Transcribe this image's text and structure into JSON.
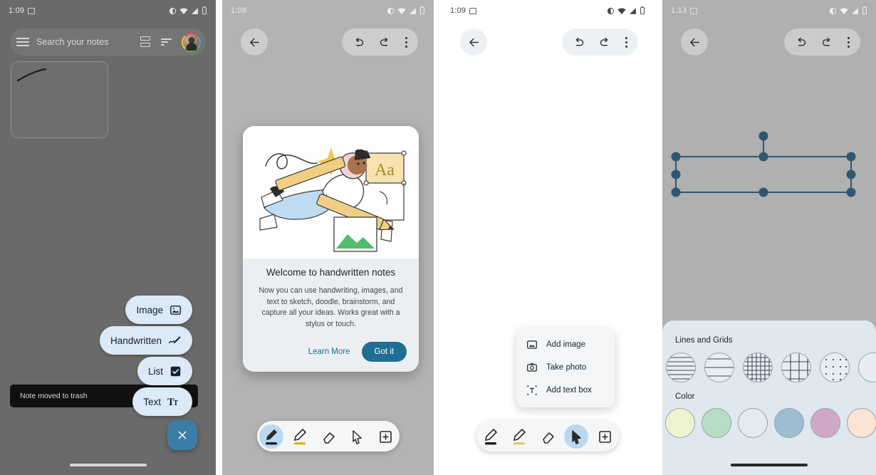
{
  "panel1": {
    "status": {
      "time": "1:09",
      "screenshot_icon": "screenshot-icon",
      "icons": [
        "dnd-icon",
        "wifi-icon",
        "signal-icon",
        "battery-icon"
      ]
    },
    "search": {
      "placeholder": "Search your notes",
      "menu_icon": "hamburger-menu-icon",
      "view_icon": "view-toggle-icon",
      "sort_icon": "sort-icon",
      "avatar": "account-avatar"
    },
    "snackbar": {
      "message": "Note moved to trash"
    },
    "fab_menu": [
      {
        "label": "Image",
        "icon": "image-icon"
      },
      {
        "label": "Handwritten",
        "icon": "handwriting-pen-icon"
      },
      {
        "label": "List",
        "icon": "checkbox-icon"
      },
      {
        "label": "Text",
        "icon": "text-format-icon"
      }
    ],
    "fab_main": {
      "icon": "close-icon",
      "color": "#3b7ea5"
    }
  },
  "panel2": {
    "status": {
      "time": "1:08",
      "icons": [
        "dnd-icon",
        "wifi-icon",
        "signal-icon",
        "battery-icon"
      ]
    },
    "appbar": {
      "back": "back-arrow-icon",
      "undo": "undo-icon",
      "redo": "redo-icon",
      "more": "overflow-menu-icon"
    },
    "dialog": {
      "title": "Welcome to handwritten notes",
      "body": "Now you can use handwriting, images, and text to sketch, doodle, brainstorm, and capture all your ideas. Works great with a stylus or touch.",
      "link": "Learn More",
      "button": "Got it",
      "button_color": "#1f6f94",
      "illustration": "person-with-pencil-illustration",
      "illustration_text": "Aa"
    },
    "toolbar": [
      {
        "icon": "pen-icon",
        "selected": true,
        "swatch": "#1c1c1c"
      },
      {
        "icon": "highlighter-icon",
        "selected": false,
        "swatch": "#d8b500"
      },
      {
        "icon": "eraser-icon",
        "selected": false,
        "swatch": ""
      },
      {
        "icon": "select-cursor-icon",
        "selected": false,
        "swatch": ""
      },
      {
        "icon": "add-box-icon",
        "selected": false,
        "swatch": ""
      }
    ]
  },
  "panel3": {
    "status": {
      "time": "1:09",
      "screenshot_icon": "screenshot-icon",
      "icons": [
        "dnd-icon",
        "wifi-icon",
        "signal-icon",
        "battery-icon"
      ]
    },
    "appbar": {
      "back": "back-arrow-icon",
      "undo": "undo-icon",
      "redo": "redo-icon",
      "more": "overflow-menu-icon"
    },
    "menu": [
      {
        "label": "Add image",
        "icon": "image-icon"
      },
      {
        "label": "Take photo",
        "icon": "camera-icon"
      },
      {
        "label": "Add text box",
        "icon": "text-box-icon"
      }
    ],
    "toolbar": [
      {
        "icon": "pen-icon",
        "selected": false,
        "swatch": "#1c1c1c"
      },
      {
        "icon": "highlighter-icon",
        "selected": false,
        "swatch": "#d8b500"
      },
      {
        "icon": "eraser-icon",
        "selected": false,
        "swatch": ""
      },
      {
        "icon": "select-cursor-icon",
        "selected": true,
        "swatch": ""
      },
      {
        "icon": "add-box-icon",
        "selected": false,
        "swatch": ""
      }
    ]
  },
  "panel4": {
    "status": {
      "time": "1:13",
      "screenshot_icon": "screenshot-icon",
      "icons": [
        "dnd-icon",
        "wifi-icon",
        "signal-icon",
        "battery-icon"
      ]
    },
    "appbar": {
      "back": "back-arrow-icon",
      "undo": "undo-icon",
      "redo": "redo-icon",
      "more": "overflow-menu-icon"
    },
    "selection": {
      "name": "selection-handles",
      "handle_color": "#2f5772",
      "handle_count": 8,
      "rotate_handle": true
    },
    "sheet": {
      "lines_label": "Lines and Grids",
      "color_label": "Color",
      "patterns": [
        "narrow-ruled",
        "wide-ruled",
        "fine-grid",
        "large-grid",
        "dotted",
        "blank"
      ],
      "colors": [
        "#eef3cf",
        "#b8ddc5",
        "#e3eaf0",
        "#9dbdd0",
        "#cfa8c8",
        "#fbe4d4",
        "#ece0ba",
        "#fbfbf9"
      ]
    }
  }
}
